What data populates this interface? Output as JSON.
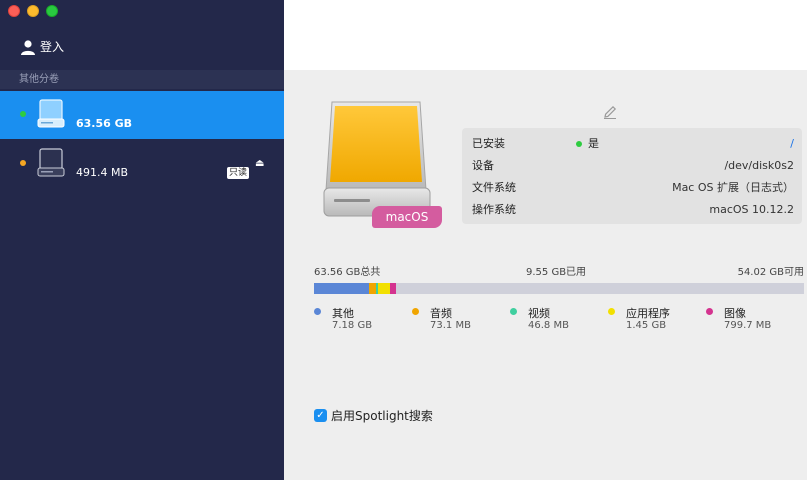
{
  "sidebar": {
    "login_label": "登入",
    "section_label": "其他分卷",
    "volumes": [
      {
        "size": "63.56 GB",
        "status_color": "#2ecc40",
        "selected": true,
        "badge": "",
        "eject": ""
      },
      {
        "size": "491.4 MB",
        "status_color": "#f5a623",
        "selected": false,
        "badge": "只读",
        "eject": "⏏"
      }
    ]
  },
  "main": {
    "os_tag": "macOS",
    "info": {
      "mounted_label": "已安装",
      "mounted_value": "是",
      "mounted_path": "/",
      "device_label": "设备",
      "device_value": "/dev/disk0s2",
      "fs_label": "文件系统",
      "fs_value": "Mac OS 扩展（日志式）",
      "os_label": "操作系统",
      "os_value": "macOS 10.12.2"
    },
    "capacity": {
      "total": "63.56 GB总共",
      "used": "9.55 GB已用",
      "available": "54.02 GB可用"
    },
    "usage": [
      {
        "name": "其他",
        "value": "7.18 GB",
        "color": "#5a86d6",
        "fraction": 0.113
      },
      {
        "name": "音频",
        "value": "73.1 MB",
        "color": "#f0a500",
        "fraction": 0.0012
      },
      {
        "name": "视频",
        "value": "46.8 MB",
        "color": "#3fcf9f",
        "fraction": 0.0008
      },
      {
        "name": "应用程序",
        "value": "1.45 GB",
        "color": "#f2e000",
        "fraction": 0.0228
      },
      {
        "name": "图像",
        "value": "799.7 MB",
        "color": "#d4338f",
        "fraction": 0.0126
      }
    ],
    "spotlight_label": "启用Spotlight搜索",
    "spotlight_checked": true
  }
}
